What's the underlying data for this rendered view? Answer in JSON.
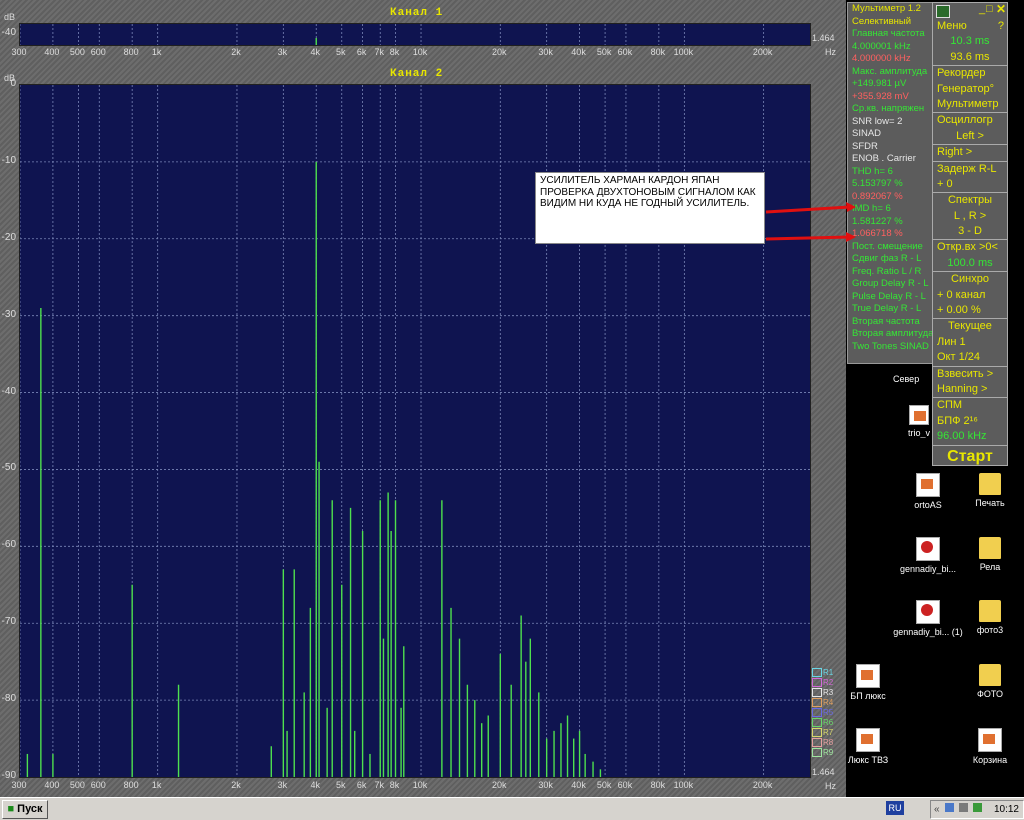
{
  "channel1": {
    "title": "Канал 1",
    "unit": "dB",
    "y_label": "-40",
    "right_label": "1.464",
    "hz_label": "Hz"
  },
  "channel2": {
    "title": "Канал 2",
    "unit": "dB",
    "right_label": "1.464",
    "hz_label": "Hz",
    "legend": [
      "R1",
      "R2",
      "R3",
      "R4",
      "R5",
      "R6",
      "R7",
      "R8",
      "R9"
    ],
    "legend_colors": [
      "#6ad7e6",
      "#d26ad7",
      "#e6e6e6",
      "#e0a060",
      "#6a6ae6",
      "#6ad76a",
      "#d7d76a",
      "#e6a0a0",
      "#a0e6a0"
    ]
  },
  "x_ticks": [
    "300",
    "400",
    "500",
    "600",
    "800",
    "1k",
    "2k",
    "3k",
    "4k",
    "5k",
    "6k",
    "7k",
    "8k",
    "10k",
    "20k",
    "30k",
    "40k",
    "50k",
    "60k",
    "80k",
    "100k",
    "200k"
  ],
  "y_ticks": [
    "0",
    "-10",
    "-20",
    "-30",
    "-40",
    "-50",
    "-60",
    "-70",
    "-80",
    "-90"
  ],
  "chart_data": {
    "type": "bar",
    "title": "Канал 2",
    "ylabel": "dB",
    "xlabel": "Hz",
    "xscale": "log",
    "xlim": [
      300,
      300000
    ],
    "ylim": [
      -90,
      0
    ],
    "grid": true,
    "x": [
      320,
      360,
      400,
      800,
      1200,
      2700,
      3000,
      3100,
      3300,
      3600,
      3800,
      4000,
      4100,
      4400,
      4600,
      5000,
      5400,
      5600,
      6000,
      6400,
      7000,
      7200,
      7500,
      7700,
      8000,
      8400,
      8600,
      12000,
      13000,
      14000,
      15000,
      16000,
      17000,
      18000,
      20000,
      22000,
      24000,
      25000,
      26000,
      28000,
      30000,
      32000,
      34000,
      36000,
      38000,
      40000,
      42000,
      45000,
      48000
    ],
    "values": [
      -87,
      -29,
      -87,
      -65,
      -78,
      -86,
      -63,
      -84,
      -63,
      -79,
      -68,
      -10,
      -49,
      -81,
      -54,
      -65,
      -55,
      -84,
      -58,
      -87,
      -54,
      -72,
      -53,
      -58,
      -54,
      -81,
      -73,
      -54,
      -68,
      -72,
      -78,
      -80,
      -83,
      -82,
      -74,
      -78,
      -69,
      -75,
      -72,
      -79,
      -85,
      -84,
      -83,
      -82,
      -85,
      -84,
      -87,
      -88,
      -89
    ]
  },
  "multimeter": {
    "title": "Мультиметр 1.2",
    "rows": [
      {
        "text": "Селективный",
        "color": "yellow"
      },
      {
        "text": "Главная частота",
        "color": "green"
      },
      {
        "text": "4.000001 kHz",
        "color": "green"
      },
      {
        "text": "4.000000 kHz",
        "color": "red"
      },
      {
        "text": "Макс. амплитуда",
        "color": "green"
      },
      {
        "text": "+149.981 µV",
        "color": "green"
      },
      {
        "text": "+355.928 mV",
        "color": "red"
      },
      {
        "text": "Ср.кв. напряжен",
        "color": "green"
      },
      {
        "text": "SNR   low= 2",
        "color": "white"
      },
      {
        "text": "SINAD",
        "color": "white"
      },
      {
        "text": "SFDR",
        "color": "white"
      },
      {
        "text": "ENOB . Carrier",
        "color": "white"
      },
      {
        "text": "THD     h=  6",
        "color": "green"
      },
      {
        "text": "5.153797 %",
        "color": "green"
      },
      {
        "text": "0.892067 %",
        "color": "red"
      },
      {
        "text": "IMD     h=  6",
        "color": "green"
      },
      {
        "text": "1.581227 %",
        "color": "green"
      },
      {
        "text": "1.066718 %",
        "color": "red"
      },
      {
        "text": "Пост. смещение",
        "color": "green"
      },
      {
        "text": "Сдвиг фаз R - L",
        "color": "green"
      },
      {
        "text": "Freq. Ratio  L / R",
        "color": "green"
      },
      {
        "text": "Group Delay R - L",
        "color": "green"
      },
      {
        "text": "Pulse Delay R - L",
        "color": "green"
      },
      {
        "text": "True Delay R - L",
        "color": "green"
      },
      {
        "text": "Вторая частота",
        "color": "green"
      },
      {
        "text": "Вторая амплитуда",
        "color": "green"
      },
      {
        "text": "Two Tones SINAD",
        "color": "green"
      }
    ]
  },
  "right_panel": {
    "menu_label": "Меню",
    "help": "?",
    "time1": "10.3 ms",
    "time2": "93.6 ms",
    "items": [
      {
        "text": "Рекордер",
        "sep": true
      },
      {
        "text": "Генератор°"
      },
      {
        "text": "Мультиметр"
      },
      {
        "text": "Осциллогр",
        "sep": true
      },
      {
        "text": "Left  >",
        "center": true
      },
      {
        "text": "Right  >",
        "sep": true
      },
      {
        "text": "Задерж R-L",
        "sep": true
      },
      {
        "text": "+      0"
      },
      {
        "text": "Спектры",
        "sep": true,
        "center": true
      },
      {
        "text": "L , R  >",
        "center": true
      },
      {
        "text": "3 - D",
        "center": true
      },
      {
        "text": "Откр.вх >0<",
        "sep": true
      },
      {
        "text": "100.0 ms",
        "green": true,
        "center": true
      },
      {
        "text": "Синхро",
        "sep": true,
        "center": true
      },
      {
        "text": "+  0 канал"
      },
      {
        "text": "+  0.00 %"
      },
      {
        "text": "Текущее",
        "sep": true,
        "center": true
      },
      {
        "text": "Лин      1"
      },
      {
        "text": "Окт  1/24"
      },
      {
        "text": "Взвесить >",
        "sep": true
      },
      {
        "text": "Hanning >"
      },
      {
        "text": "СПМ",
        "sep": true
      },
      {
        "text": "БПФ  2¹⁶"
      },
      {
        "text": "96.00 kHz",
        "green": true
      }
    ],
    "start": "Старт"
  },
  "annotation": "УСИЛИТЕЛЬ  ХАРМАН  КАРДОН  ЯПАН ПРОВЕРКА  ДВУХТОНОВЫМ  СИГНАЛОМ КАК  ВИДИМ НИ КУДА НЕ ГОДНЫЙ УСИЛИТЕЛЬ.",
  "desktop": {
    "partial_labels": [
      "Север",
      "trio_v"
    ],
    "icons": [
      {
        "label": "ortoAS",
        "type": "docx"
      },
      {
        "label": "Печать",
        "type": "folder"
      },
      {
        "label": "gennadiy_bi...",
        "type": "mp3"
      },
      {
        "label": "Рела",
        "type": "folder"
      },
      {
        "label": "gennadiy_bi... (1)",
        "type": "mp3"
      },
      {
        "label": "фото3",
        "type": "folder"
      },
      {
        "label": "БП люкс",
        "type": "docx"
      },
      {
        "label": "ФОТО",
        "type": "folder"
      },
      {
        "label": "Люкс ТВЗ",
        "type": "docx"
      },
      {
        "label": "Корзина",
        "type": "recycle"
      }
    ]
  },
  "taskbar": {
    "start": "Пуск",
    "lang": "RU",
    "time": "10:12"
  }
}
